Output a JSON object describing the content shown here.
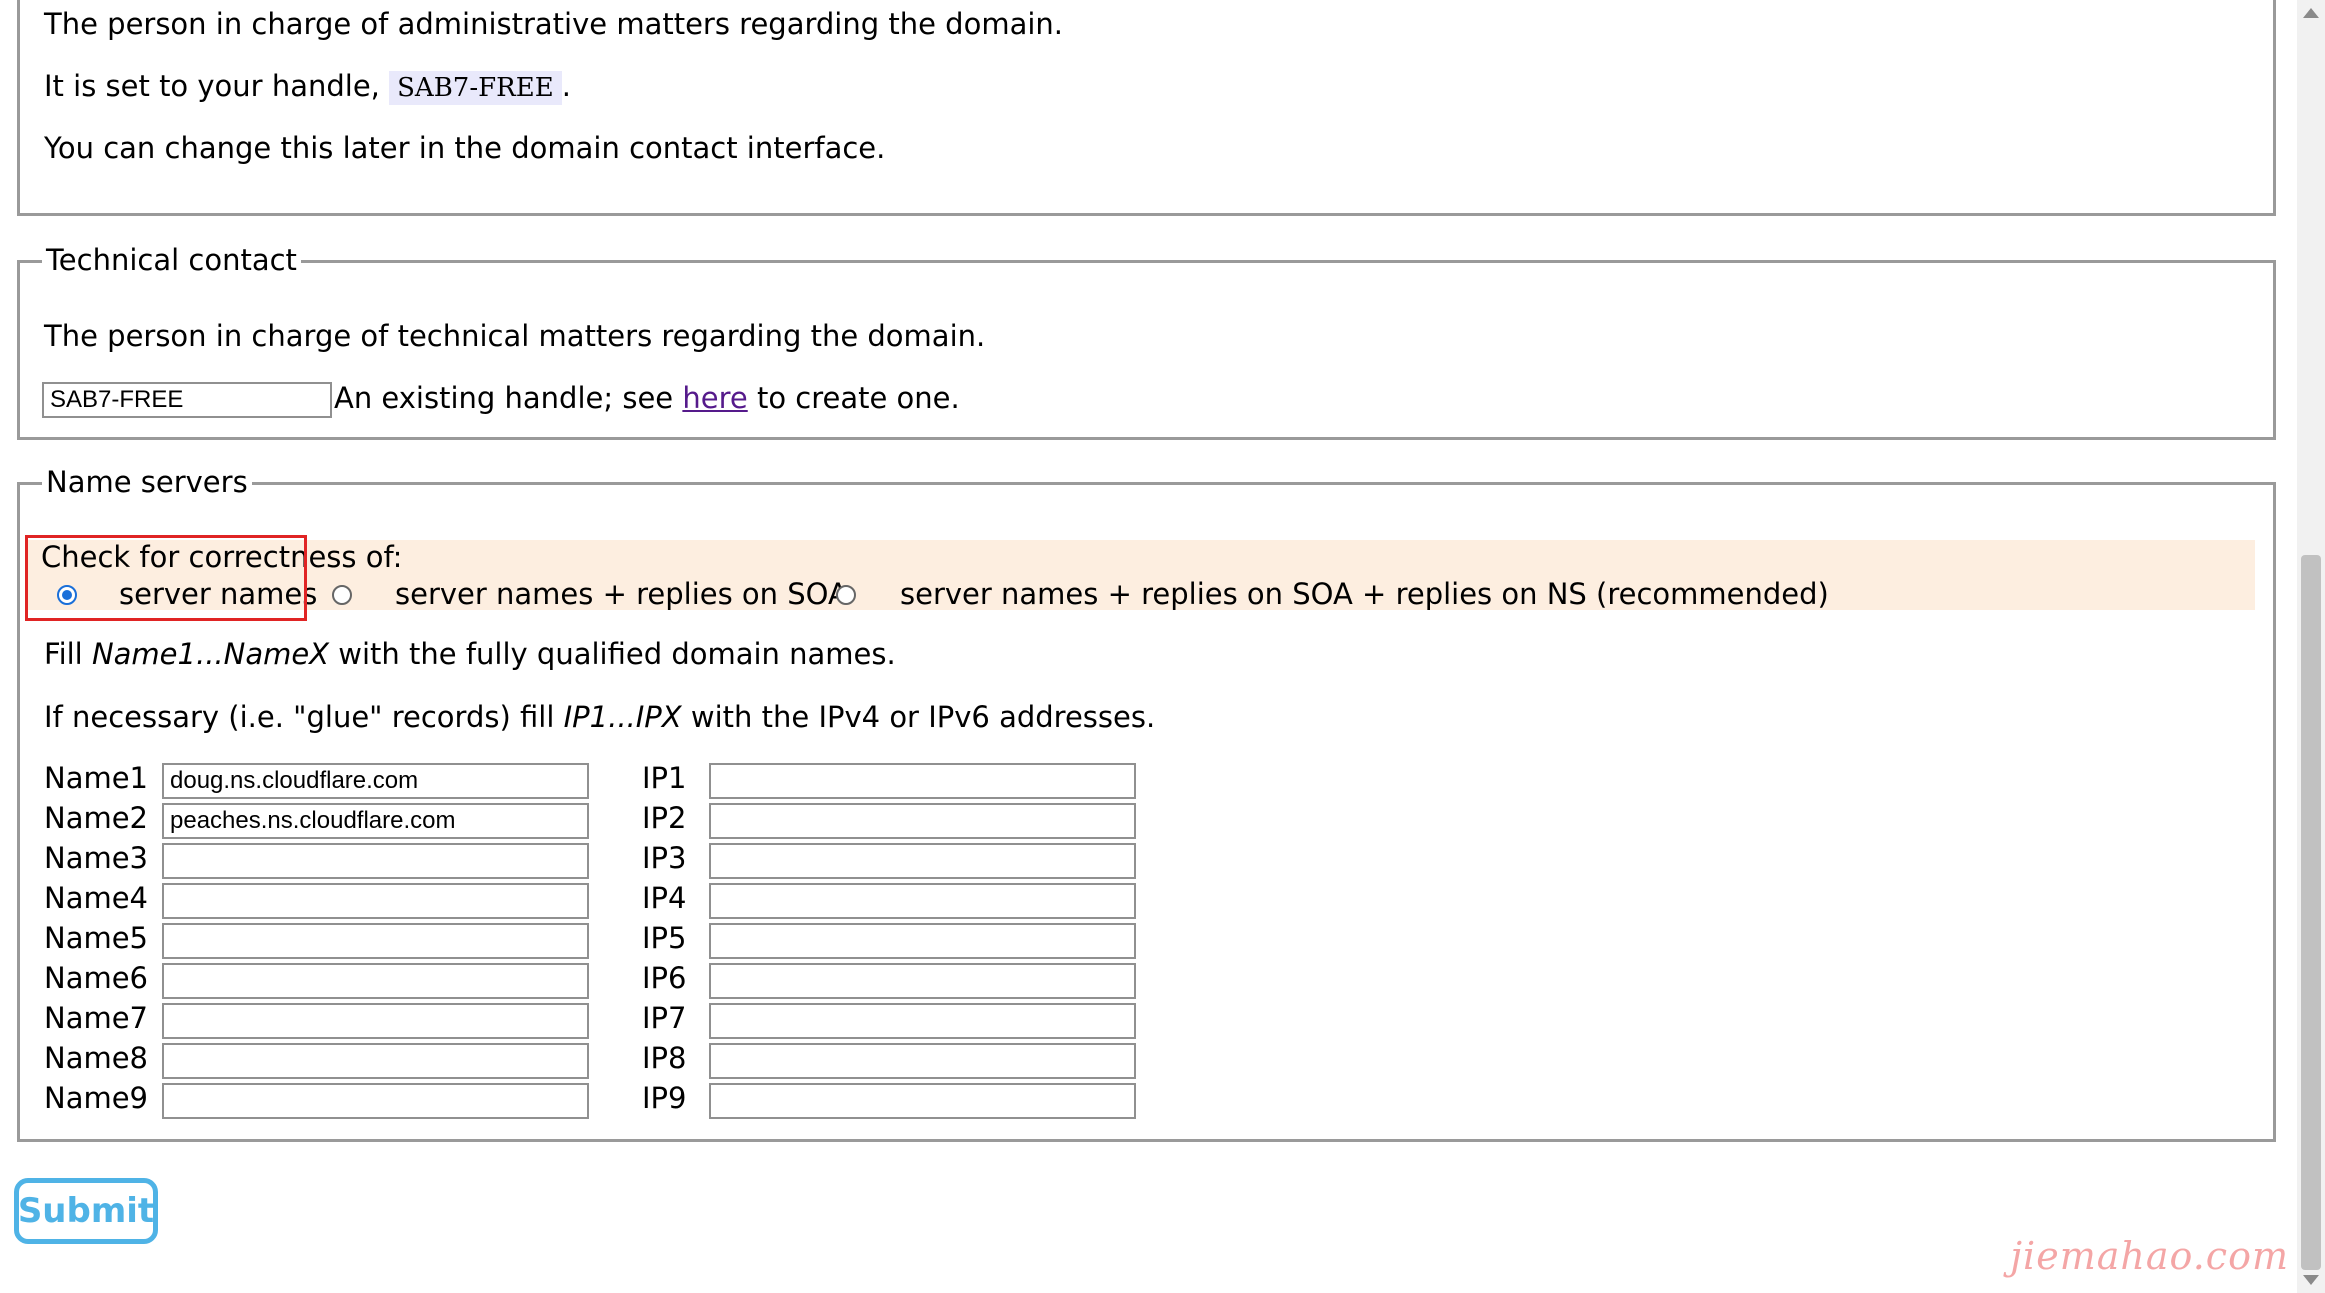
{
  "admin": {
    "desc": "The person in charge of administrative matters regarding the domain.",
    "handle_prefix": "It is set to your handle,",
    "handle": "SAB7-FREE",
    "handle_suffix": ".",
    "note": "You can change this later in the domain contact interface."
  },
  "tech": {
    "legend": "Technical contact",
    "desc": "The person in charge of technical matters regarding the domain.",
    "handle_value": "SAB7-FREE",
    "hint_prefix": "An existing handle; see",
    "hint_link": "here",
    "hint_suffix": "to create one."
  },
  "ns": {
    "legend": "Name servers",
    "check_label": "Check for correctness of:",
    "options": [
      {
        "label": "server names",
        "selected": true
      },
      {
        "label": "server names + replies on SOA",
        "selected": false
      },
      {
        "label": "server names + replies on SOA + replies on NS (recommended)",
        "selected": false
      }
    ],
    "fill_prefix": "Fill",
    "fill_em": "Name1...NameX",
    "fill_suffix": "with the fully qualified domain names.",
    "glue_prefix": "If necessary (i.e. \"glue\" records) fill",
    "glue_em": "IP1...IPX",
    "glue_suffix": "with the IPv4 or IPv6 addresses.",
    "rows": [
      {
        "name_label": "Name1",
        "name_value": "doug.ns.cloudflare.com",
        "ip_label": "IP1",
        "ip_value": ""
      },
      {
        "name_label": "Name2",
        "name_value": "peaches.ns.cloudflare.com",
        "ip_label": "IP2",
        "ip_value": ""
      },
      {
        "name_label": "Name3",
        "name_value": "",
        "ip_label": "IP3",
        "ip_value": ""
      },
      {
        "name_label": "Name4",
        "name_value": "",
        "ip_label": "IP4",
        "ip_value": ""
      },
      {
        "name_label": "Name5",
        "name_value": "",
        "ip_label": "IP5",
        "ip_value": ""
      },
      {
        "name_label": "Name6",
        "name_value": "",
        "ip_label": "IP6",
        "ip_value": ""
      },
      {
        "name_label": "Name7",
        "name_value": "",
        "ip_label": "IP7",
        "ip_value": ""
      },
      {
        "name_label": "Name8",
        "name_value": "",
        "ip_label": "IP8",
        "ip_value": ""
      },
      {
        "name_label": "Name9",
        "name_value": "",
        "ip_label": "IP9",
        "ip_value": ""
      }
    ]
  },
  "submit_label": "Submit",
  "watermark": "jiemahao.com",
  "colors": {
    "radio_selected": "#1a6fd9",
    "option_bg": "#fdeee0",
    "highlight_box": "#e02424",
    "submit": "#4fb3e6"
  }
}
